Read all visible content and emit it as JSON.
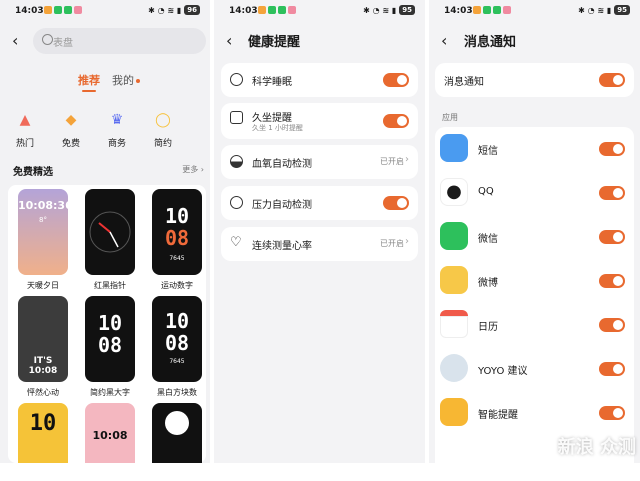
{
  "status": {
    "time": "14:03",
    "batt1": "96",
    "batt2": "95",
    "batt3": "95"
  },
  "panel1": {
    "search_placeholder": "表盘",
    "tabs": [
      {
        "label": "推荐"
      },
      {
        "label": "我的"
      }
    ],
    "categories": [
      {
        "label": "热门",
        "icon": "flame-icon",
        "color": "#f06a5a"
      },
      {
        "label": "免费",
        "icon": "tag-icon",
        "color": "#f4a33a"
      },
      {
        "label": "商务",
        "icon": "crown-icon",
        "color": "#5a6cf0"
      },
      {
        "label": "简约",
        "icon": "watch-icon",
        "color": "#f7c23d"
      }
    ],
    "section_title": "免费精选",
    "more_label": "更多",
    "faces": [
      {
        "name": "天暖夕日",
        "bg": "#b4a4d8",
        "time": "10:08:36"
      },
      {
        "name": "红黑指针",
        "bg": "#111111",
        "time": ""
      },
      {
        "name": "运动数字",
        "bg": "#111111",
        "time": "10 08"
      },
      {
        "name": "怦然心动",
        "bg": "#4a4a4a",
        "time": "10:08"
      },
      {
        "name": "简约黑大字",
        "bg": "#111111",
        "time": "10 08"
      },
      {
        "name": "黑白方块数",
        "bg": "#111111",
        "time": "10 08"
      },
      {
        "name": "",
        "bg": "#f5c338",
        "time": "10"
      },
      {
        "name": "",
        "bg": "#f4b7c0",
        "time": "10:08"
      },
      {
        "name": "",
        "bg": "#111111",
        "time": ""
      }
    ],
    "face_values": {
      "face0_weather": "8°",
      "face2_steps": "7645",
      "face3_text": "IT'S 10:08",
      "face5_steps": "7645"
    }
  },
  "panel2": {
    "title": "健康提醒",
    "rows": [
      {
        "label": "科学睡眠",
        "sub": "",
        "state": "toggle"
      },
      {
        "label": "久坐提醒",
        "sub": "久坐 1 小时提醒",
        "state": "toggle"
      },
      {
        "label": "血氧自动检测",
        "sub": "",
        "state": "已开启"
      },
      {
        "label": "压力自动检测",
        "sub": "",
        "state": "toggle"
      },
      {
        "label": "连续测量心率",
        "sub": "",
        "state": "已开启"
      }
    ]
  },
  "panel3": {
    "title": "消息通知",
    "master_label": "消息通知",
    "section_label": "应用",
    "apps": [
      {
        "label": "短信",
        "color": "#4a9bf0"
      },
      {
        "label": "QQ",
        "color": "#ffffff"
      },
      {
        "label": "微信",
        "color": "#2dc05c"
      },
      {
        "label": "微博",
        "color": "#f7c848"
      },
      {
        "label": "日历",
        "color": "#f05a4a"
      },
      {
        "label": "YOYO 建议",
        "color": "#d9e3ec"
      },
      {
        "label": "智能提醒",
        "color": "#f7b733"
      }
    ]
  },
  "watermark": "新浪 众测"
}
